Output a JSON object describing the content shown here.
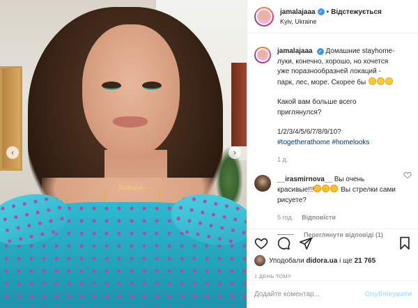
{
  "post": {
    "username": "jamalajaaa",
    "follow_label": "Відстежується",
    "dot": "•",
    "location": "Kyiv, Ukraine",
    "image_tag_text": "Jamala",
    "prev_arrow": "‹",
    "next_arrow": "›"
  },
  "caption": {
    "username": "jamalajaaa",
    "text_main": "Домашние stayhome-луки, конечно, хорошо, но хочется уже поразнообразней локаций - парк, лес, море. Скорее бы",
    "question": "Какой вам больше всего приглянулся?",
    "options": "1/2/3/4/5/6/7/8/9/10?",
    "hashtag1": "#togetherathome",
    "hashtag2": "#homelooks",
    "time": "1 д."
  },
  "comment": {
    "username": "__irasmirnova__",
    "text_a": "Вы очень красивые!!!",
    "text_b": "Вы стрелки сами рисуете?",
    "time": "5 год.",
    "reply_label": "Відповісти",
    "view_replies": "Переглянути відповіді (1)"
  },
  "actions": {
    "likes_prefix": "Уподобали",
    "likes_user": "didora.ua",
    "likes_middle": "і ще",
    "likes_count": "21 765",
    "posted": "1 ДЕНЬ ТОМУ"
  },
  "add_comment": {
    "placeholder": "Додайте коментар...",
    "publish_label": "Опублікувати"
  },
  "colors": {
    "link": "#00376b",
    "verified": "#3897f0",
    "muted": "#8e8e8e",
    "publish_disabled": "#b2dffc"
  },
  "icons": [
    "chevron-left-icon",
    "chevron-right-icon",
    "verified-badge-icon",
    "heart-icon",
    "comment-icon",
    "share-icon",
    "bookmark-icon"
  ]
}
